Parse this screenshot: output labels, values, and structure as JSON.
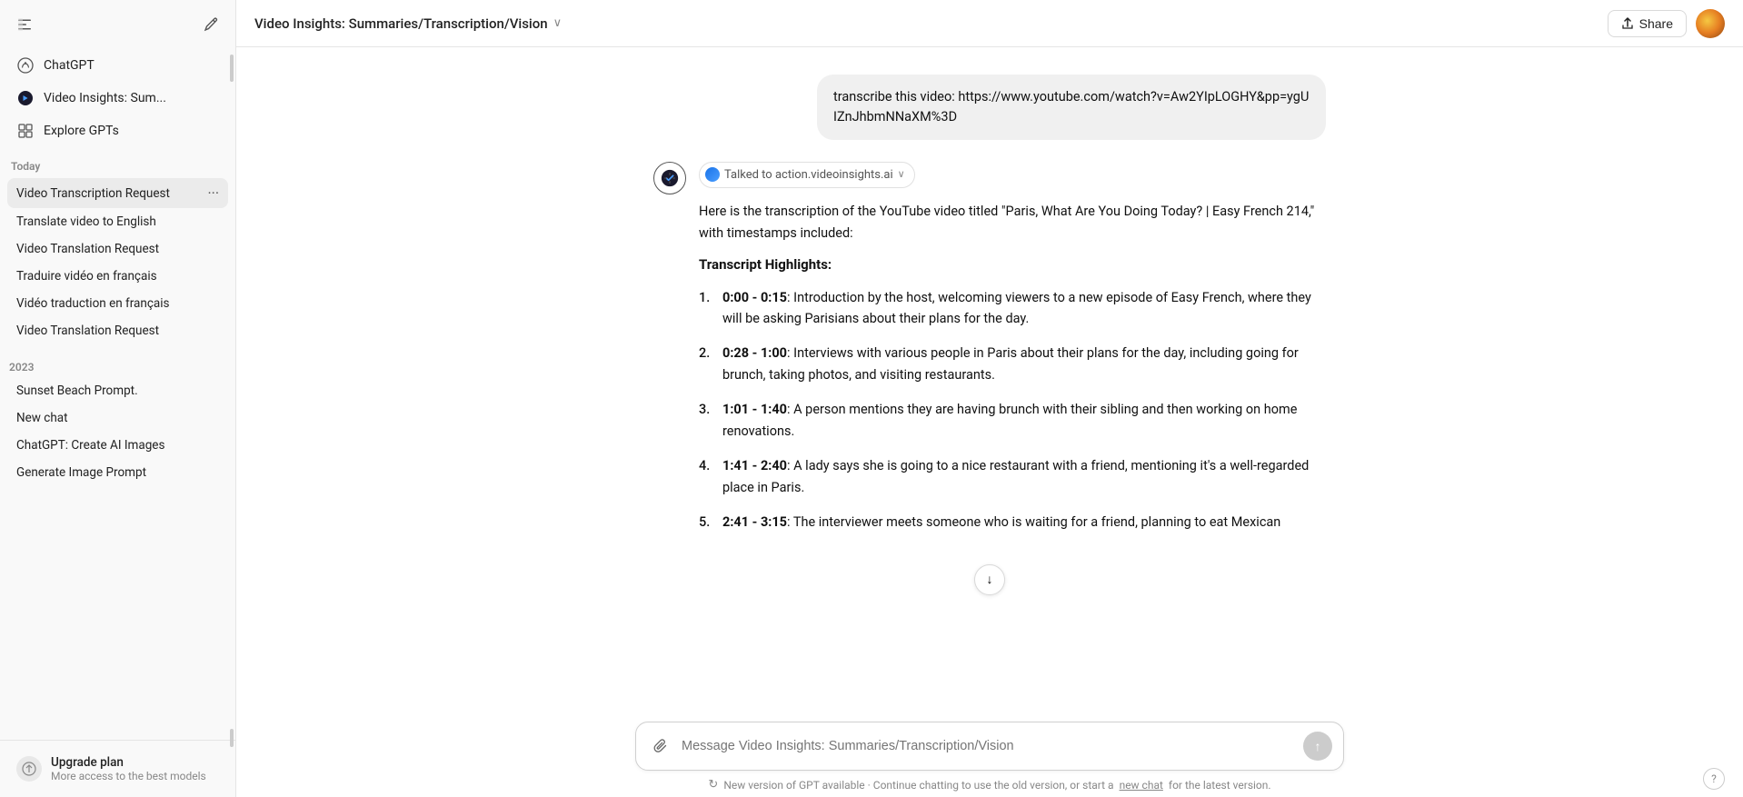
{
  "sidebar": {
    "toggle_label": "Toggle sidebar",
    "new_chat_label": "New chat",
    "nav_items": [
      {
        "id": "chatgpt",
        "label": "ChatGPT",
        "icon": "chat"
      },
      {
        "id": "video-insights",
        "label": "Video Insights: Sum...",
        "icon": "video"
      },
      {
        "id": "explore-gpts",
        "label": "Explore GPTs",
        "icon": "grid"
      }
    ],
    "section_today": "Today",
    "today_items": [
      {
        "id": "video-transcription",
        "label": "Video Transcription Request",
        "active": true
      },
      {
        "id": "translate-video",
        "label": "Translate video to English"
      },
      {
        "id": "video-translation-1",
        "label": "Video Translation Request"
      },
      {
        "id": "traduire-video",
        "label": "Traduire vidéo en français"
      },
      {
        "id": "video-traduction",
        "label": "Vidéo traduction en français"
      },
      {
        "id": "video-translation-2",
        "label": "Video Translation Request"
      }
    ],
    "section_2023": "2023",
    "past_items": [
      {
        "id": "sunset-beach",
        "label": "Sunset Beach Prompt."
      },
      {
        "id": "new-chat",
        "label": "New chat"
      },
      {
        "id": "create-ai-images",
        "label": "ChatGPT: Create AI Images"
      },
      {
        "id": "generate-image",
        "label": "Generate Image Prompt"
      }
    ],
    "upgrade_plan_label": "Upgrade plan",
    "upgrade_plan_sub": "More access to the best models"
  },
  "header": {
    "title": "Video Insights: Summaries/Transcription/Vision",
    "share_label": "Share"
  },
  "chat": {
    "user_message": "transcribe this video: https://www.youtube.com/watch?v=Aw2YIpLOGHY&pp=ygUIZnJhbmNNaXM%3D",
    "talked_to": "Talked to action.videoinsights.ai",
    "intro": "Here is the transcription of the YouTube video titled \"Paris, What Are You Doing Today? | Easy French 214,\" with timestamps included:",
    "highlights_title": "Transcript Highlights:",
    "transcript_items": [
      {
        "num": "1.",
        "timestamp": "0:00 - 0:15",
        "text": ": Introduction by the host, welcoming viewers to a new episode of Easy French, where they will be asking Parisians about their plans for the day."
      },
      {
        "num": "2.",
        "timestamp": "0:28 - 1:00",
        "text": ": Interviews with various people in Paris about their plans for the day, including going for brunch, taking photos, and visiting restaurants."
      },
      {
        "num": "3.",
        "timestamp": "1:01 - 1:40",
        "text": ": A person mentions they are having brunch with their sibling and then working on home renovations."
      },
      {
        "num": "4.",
        "timestamp": "1:41 - 2:40",
        "text": ": A lady says she is going to a nice restaurant with a friend, mentioning it's a well-regarded place in Paris."
      },
      {
        "num": "5.",
        "timestamp": "2:41 - 3:15",
        "text": ": The interviewer meets someone who is waiting for a friend, planning to eat Mexican"
      }
    ]
  },
  "input": {
    "placeholder": "Message Video Insights: Summaries/Transcription/Vision"
  },
  "bottom_notice": {
    "text": "New version of GPT available · Continue chatting to use the old version, or start a",
    "link_text": "new chat",
    "text_after": "for the latest version."
  },
  "icons": {
    "sidebar_toggle": "☰",
    "new_chat": "✏",
    "chat_icon": "💬",
    "grid_icon": "⊞",
    "chevron_down": "∨",
    "attach": "📎",
    "send_arrow": "↑",
    "scroll_down": "↓",
    "share_icon": "↑",
    "refresh": "↻",
    "help": "?"
  }
}
